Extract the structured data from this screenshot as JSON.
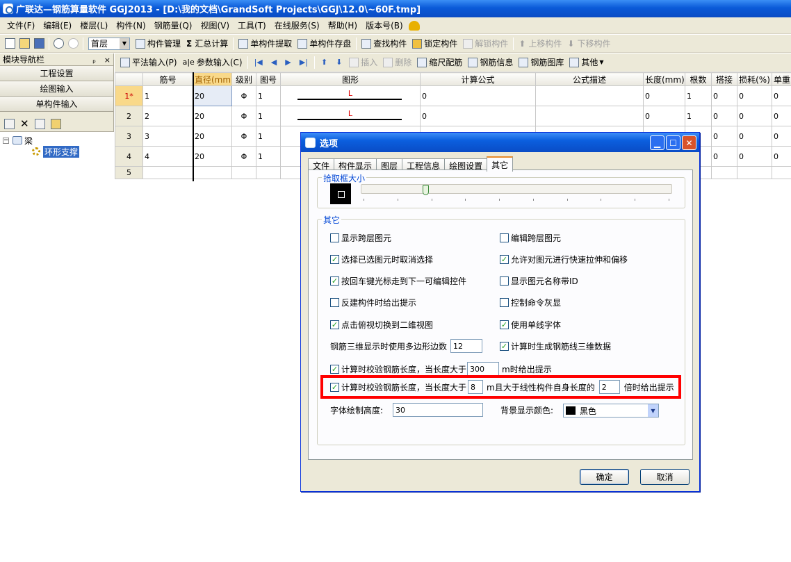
{
  "window": {
    "title": "广联达—钢筋算量软件 GGJ2013 - [D:\\我的文档\\GrandSoft Projects\\GGJ\\12.0\\~60F.tmp]"
  },
  "menu": [
    "文件(F)",
    "编辑(E)",
    "楼层(L)",
    "构件(N)",
    "钢筋量(Q)",
    "视图(V)",
    "工具(T)",
    "在线服务(S)",
    "帮助(H)",
    "版本号(B)"
  ],
  "toolbar": {
    "floor": "首层",
    "items": [
      "构件管理",
      "汇总计算",
      "单构件提取",
      "单构件存盘",
      "查找构件",
      "锁定构件",
      "解锁构件",
      "上移构件",
      "下移构件"
    ]
  },
  "sidebar": {
    "title": "模块导航栏",
    "pin": "ₚ",
    "close": "×",
    "nav": [
      "工程设置",
      "绘图输入",
      "单构件输入"
    ],
    "tree": {
      "root": "梁",
      "child": "环形支撑"
    }
  },
  "subtoolbar": {
    "items": [
      "平法输入(P)",
      "参数输入(C)",
      "插入",
      "删除",
      "缩尺配筋",
      "钢筋信息",
      "钢筋图库",
      "其他"
    ]
  },
  "grid": {
    "columns": [
      "筋号",
      "直径(mm)",
      "级别",
      "图号",
      "图形",
      "计算公式",
      "公式描述",
      "长度(mm)",
      "根数",
      "搭接",
      "损耗(%)",
      "单重"
    ],
    "rows": [
      {
        "rh": "1*",
        "jin": "1",
        "dia": "20",
        "grade": "Φ",
        "fig": "1",
        "shape": "L",
        "formula": "0",
        "desc": "",
        "len": "0",
        "count": "1",
        "lap": "0",
        "loss": "0",
        "unit": "0"
      },
      {
        "rh": "2",
        "jin": "2",
        "dia": "20",
        "grade": "Φ",
        "fig": "1",
        "shape": "L",
        "formula": "0",
        "desc": "",
        "len": "0",
        "count": "1",
        "lap": "0",
        "loss": "0",
        "unit": "0"
      },
      {
        "rh": "3",
        "jin": "3",
        "dia": "20",
        "grade": "Φ",
        "fig": "1",
        "shape": "",
        "formula": "",
        "desc": "",
        "len": "0",
        "count": "",
        "lap": "0",
        "loss": "0",
        "unit": "0"
      },
      {
        "rh": "4",
        "jin": "4",
        "dia": "20",
        "grade": "Φ",
        "fig": "1",
        "shape": "",
        "formula": "",
        "desc": "",
        "len": "0",
        "count": "",
        "lap": "0",
        "loss": "0",
        "unit": "0"
      },
      {
        "rh": "5",
        "jin": "",
        "dia": "",
        "grade": "",
        "fig": "",
        "shape": "",
        "formula": "",
        "desc": "",
        "len": "",
        "count": "",
        "lap": "",
        "loss": "",
        "unit": ""
      }
    ]
  },
  "dialog": {
    "title": "选项",
    "tabs": [
      "文件",
      "构件显示",
      "图层",
      "工程信息",
      "绘图设置",
      "其它"
    ],
    "active_tab": "其它",
    "pickbox_legend": "拾取框大小",
    "other_legend": "其它",
    "options": {
      "show_cross_floor": {
        "label": "显示跨层图元",
        "checked": false
      },
      "edit_cross_floor": {
        "label": "编辑跨层图元",
        "checked": false
      },
      "deselect_selected": {
        "label": "选择已选图元时取消选择",
        "checked": true
      },
      "quick_stretch": {
        "label": "允许对图元进行快速拉伸和偏移",
        "checked": true
      },
      "enter_next": {
        "label": "按回车键光标走到下一可编辑控件",
        "checked": true
      },
      "show_name_id": {
        "label": "显示图元名称带ID",
        "checked": false
      },
      "reverse_build_tip": {
        "label": "反建构件时给出提示",
        "checked": false
      },
      "cmd_gray": {
        "label": "控制命令灰显",
        "checked": false
      },
      "top_view_2d": {
        "label": "点击俯视切换到二维视图",
        "checked": true
      },
      "single_line_font": {
        "label": "使用单线字体",
        "checked": true
      },
      "gen_3d_data": {
        "label": "计算时生成钢筋线三维数据",
        "checked": true
      }
    },
    "polygon_label": "钢筋三维显示时使用多边形边数",
    "polygon_value": "12",
    "len_check1": {
      "label": "计算时校验钢筋长度，当长度大于",
      "value": "300",
      "suffix": "m时给出提示",
      "checked": true
    },
    "len_check2": {
      "label": "计算时校验钢筋长度，当长度大于",
      "value": "8",
      "middle": "m且大于线性构件自身长度的",
      "value2": "2",
      "suffix": "倍时给出提示",
      "checked": true
    },
    "font_height_label": "字体绘制高度:",
    "font_height_value": "30",
    "bg_color_label": "背景显示颜色:",
    "bg_color_value": "黑色",
    "ok": "确定",
    "cancel": "取消"
  }
}
